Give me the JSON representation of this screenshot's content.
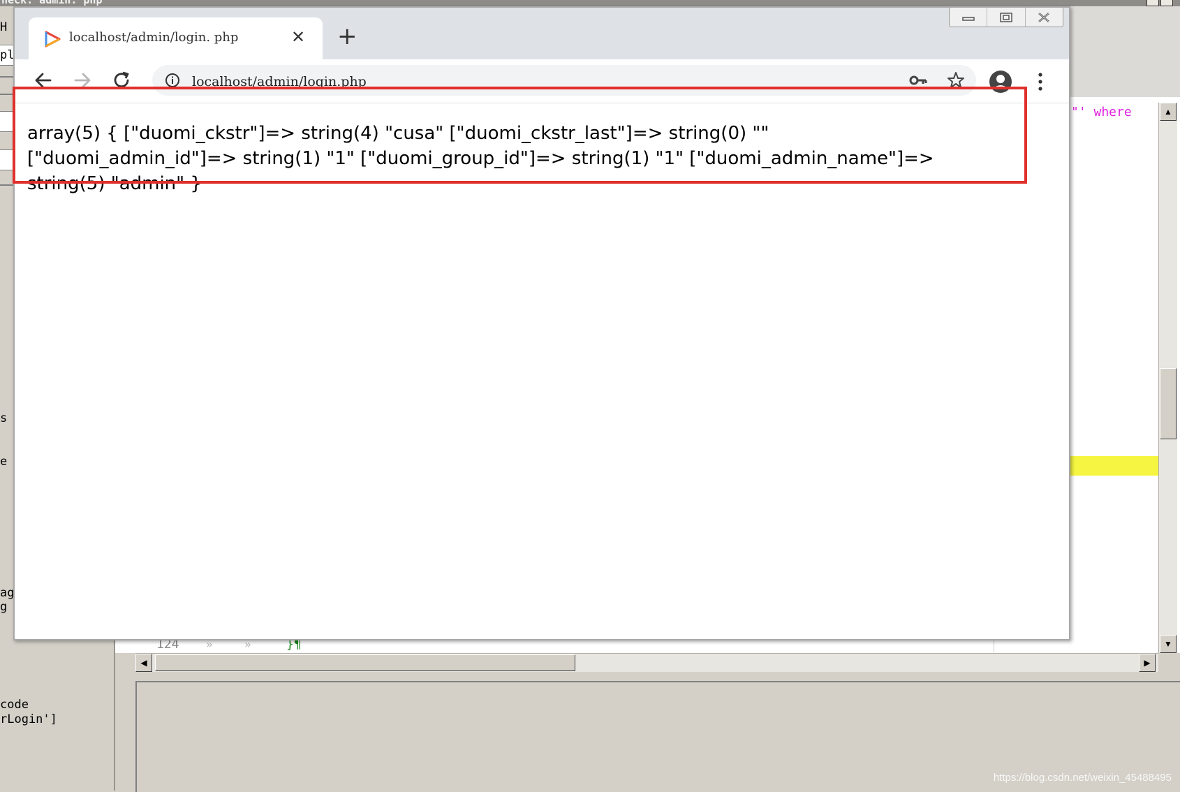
{
  "editor": {
    "title": "heck: admin. php",
    "left_panel_fragments": [
      "H",
      "pl",
      "s",
      "e",
      "ag",
      "g"
    ],
    "left_bottom_lines": [
      "code",
      "rLogin']"
    ],
    "code_token": "\"' where",
    "line_number": "124",
    "code_whitespace_marks": [
      "»",
      "»"
    ],
    "code_brace": "}¶"
  },
  "browser": {
    "tab_title": "localhost/admin/login. php",
    "tab_close_symbol": "✕",
    "new_tab_symbol": "+",
    "url": "localhost/admin/login.php",
    "window_controls": [
      "minimize",
      "maximize",
      "close"
    ]
  },
  "page": {
    "dump_text": "array(5) { [\"duomi_ckstr\"]=> string(4) \"cusa\" [\"duomi_ckstr_last\"]=> string(0) \"\" [\"duomi_admin_id\"]=> string(1) \"1\" [\"duomi_group_id\"]=> string(1) \"1\" [\"duomi_admin_name\"]=> string(5) \"admin\" }"
  },
  "watermark": "https://blog.csdn.net/weixin_45488495",
  "colors": {
    "highlight_box": "#e0302b",
    "tabbar": "#dee1e6",
    "code_keyword": "#e020e0",
    "current_line": "#f5f542"
  },
  "icons": [
    "favicon-play-icon",
    "back-arrow-icon",
    "forward-arrow-icon",
    "reload-icon",
    "info-icon",
    "key-icon",
    "star-icon",
    "profile-icon",
    "kebab-menu-icon"
  ]
}
